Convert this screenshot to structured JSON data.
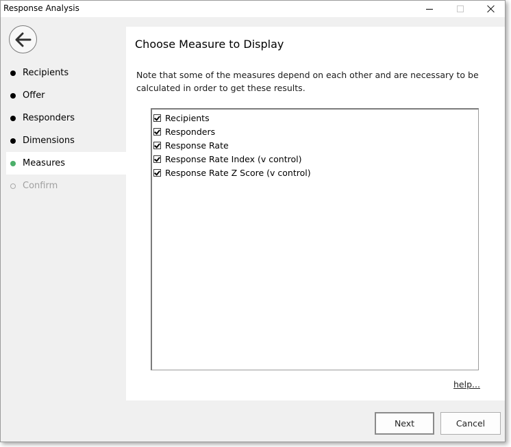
{
  "window": {
    "title": "Response Analysis"
  },
  "wizard": {
    "back_icon": "arrow-left-icon",
    "steps": [
      {
        "label": "Recipients",
        "state": "done"
      },
      {
        "label": "Offer",
        "state": "done"
      },
      {
        "label": "Responders",
        "state": "done"
      },
      {
        "label": "Dimensions",
        "state": "done"
      },
      {
        "label": "Measures",
        "state": "active"
      },
      {
        "label": "Confirm",
        "state": "disabled"
      }
    ],
    "active_color": "#4caf6a"
  },
  "main": {
    "heading": "Choose Measure to Display",
    "note_line1": "Note that some of the measures depend on each other and are necessary to be",
    "note_line2": "calculated in order to get these results.",
    "measures": [
      {
        "label": "Recipients",
        "checked": true
      },
      {
        "label": "Responders",
        "checked": true
      },
      {
        "label": "Response Rate",
        "checked": true
      },
      {
        "label": "Response Rate Index (v control)",
        "checked": true
      },
      {
        "label": "Response Rate Z Score (v control)",
        "checked": true
      }
    ],
    "help_link": "help..."
  },
  "footer": {
    "next_label": "Next",
    "cancel_label": "Cancel"
  }
}
